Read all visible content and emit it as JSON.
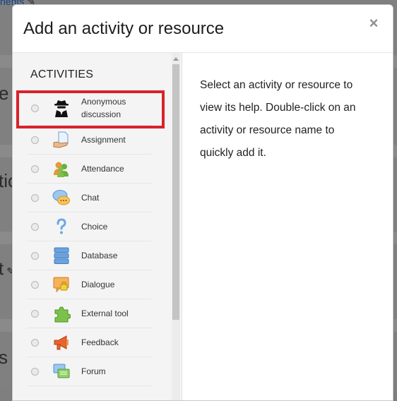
{
  "background": {
    "top_link": "nents",
    "left_texts": [
      "e",
      "tic",
      "t",
      "s"
    ]
  },
  "modal": {
    "title": "Add an activity or resource",
    "close_symbol": "×"
  },
  "activities": {
    "section_title": "ACTIVITIES",
    "items": [
      {
        "label": "Anonymous discussion",
        "icon": "anonymous-spy-icon"
      },
      {
        "label": "Assignment",
        "icon": "assignment-icon"
      },
      {
        "label": "Attendance",
        "icon": "attendance-icon"
      },
      {
        "label": "Chat",
        "icon": "chat-icon"
      },
      {
        "label": "Choice",
        "icon": "question-icon"
      },
      {
        "label": "Database",
        "icon": "database-icon"
      },
      {
        "label": "Dialogue",
        "icon": "dialogue-icon"
      },
      {
        "label": "External tool",
        "icon": "puzzle-icon"
      },
      {
        "label": "Feedback",
        "icon": "megaphone-icon"
      },
      {
        "label": "Forum",
        "icon": "forum-icon"
      }
    ]
  },
  "help": {
    "text": "Select an activity or resource to view its help. Double-click on an activity or resource name to quickly add it."
  },
  "colors": {
    "highlight": "#d8232a",
    "overlay": "#808080"
  }
}
